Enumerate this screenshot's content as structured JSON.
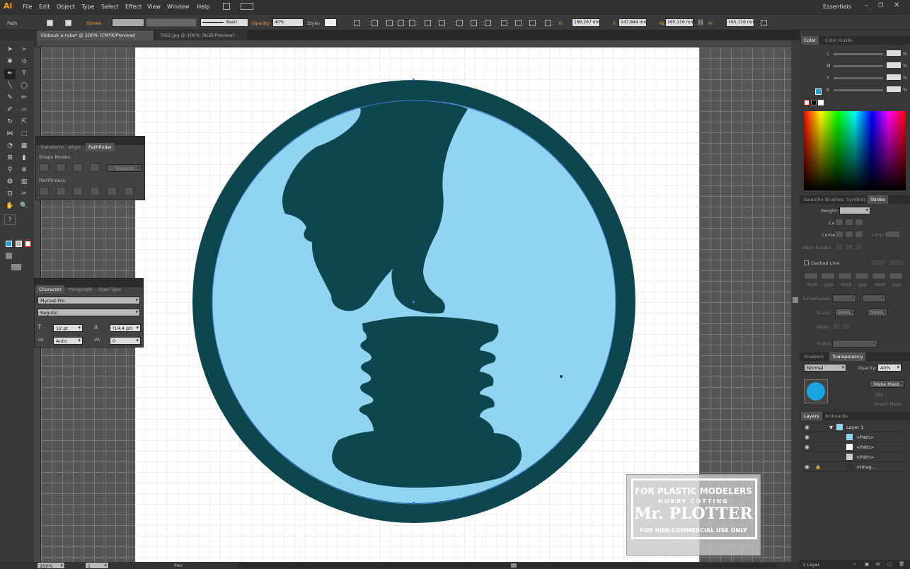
{
  "app": {
    "logo": "Ai",
    "workspace": "Essentials"
  },
  "menu": [
    "File",
    "Edit",
    "Object",
    "Type",
    "Select",
    "Effect",
    "View",
    "Window",
    "Help"
  ],
  "control": {
    "selection": "Path",
    "stroke_label": "Stroke:",
    "brush": "Basic",
    "opacity_label": "Opacity:",
    "opacity": "40%",
    "style_label": "Style:",
    "x_label": "X:",
    "x": "186,267 mm",
    "y_label": "Y:",
    "y": "147,844 mm",
    "w_label": "W:",
    "w": "165,116 mm",
    "h_label": "H:",
    "h": "165,116 mm"
  },
  "tabs": [
    {
      "label": "klobouk a ruka* @ 200% (CMYK/Preview)",
      "active": true
    },
    {
      "label": "7IG2.jpg @ 100% (RGB/Preview)",
      "active": false
    }
  ],
  "pathfinder": {
    "tabs": [
      "Transform",
      "Align",
      "Pathfinder"
    ],
    "shape_modes": "Shape Modes:",
    "expand": "Expand",
    "pathfinders": "Pathfinders:"
  },
  "character": {
    "tabs": [
      "Character",
      "Paragraph",
      "OpenType"
    ],
    "font": "Myriad Pro",
    "style": "Regular",
    "size": "12 pt",
    "leading": "(14,4 pt)",
    "kerning": "Auto",
    "tracking": "0"
  },
  "color_panel": {
    "tabs": [
      "Color",
      "Color Guide"
    ],
    "channels": [
      "C",
      "M",
      "Y",
      "K"
    ],
    "unit": "%"
  },
  "stroke_panel": {
    "tabs": [
      "Swatche",
      "Brushes",
      "Symbols",
      "Stroke"
    ],
    "weight": "Weight:",
    "cap": "Cap:",
    "corner": "Corner:",
    "limit": "Limit:",
    "align": "Align Stroke:",
    "dashed": "Dashed Line",
    "dash_labels": [
      "dash",
      "gap",
      "dash",
      "gap",
      "dash",
      "gap"
    ],
    "arrowheads": "Arrowheads:",
    "scale": "Scale:",
    "scale_values": [
      "100%",
      "100%"
    ],
    "align2": "Align:",
    "profile": "Profile:"
  },
  "transparency": {
    "tabs": [
      "Gradient",
      "Transparency"
    ],
    "mode": "Normal",
    "opacity_label": "Opacity:",
    "opacity": "40%",
    "make_mask": "Make Mask",
    "clip": "Clip",
    "invert": "Invert Mask"
  },
  "layers": {
    "tabs": [
      "Layers",
      "Artboards"
    ],
    "rows": [
      {
        "name": "Layer 1"
      },
      {
        "name": "<Path>"
      },
      {
        "name": "<Path>"
      },
      {
        "name": "<Path>"
      },
      {
        "name": "<Imag..."
      }
    ],
    "count": "1 Layer"
  },
  "status": {
    "zoom": "200%",
    "artboard": "1",
    "tool": "Pen"
  },
  "watermark": {
    "line1": "FOR PLASTIC MODELERS",
    "line2": "HOBBY CUTTING",
    "line3": "Mr. PLOTTER",
    "line4": "FOR NON-COMMERCIAL USE ONLY"
  },
  "colors": {
    "dark_teal": "#0e4650",
    "light_blue": "#90d4f2",
    "selection": "#3d7cd9",
    "swatch": "#19a5e0"
  }
}
